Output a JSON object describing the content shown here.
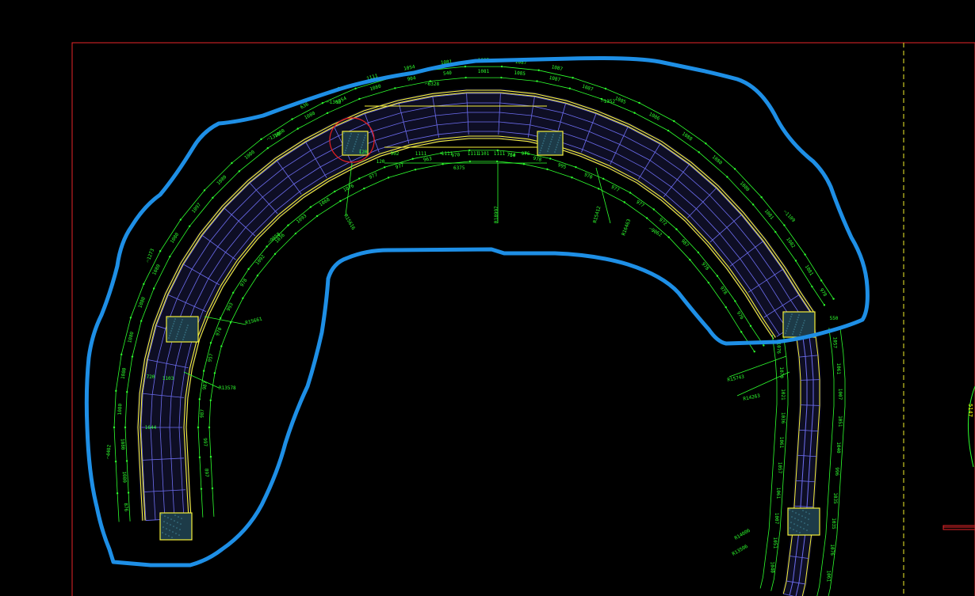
{
  "colors": {
    "background": "#000000",
    "frame": "#e8262a",
    "guide": "#f2ef2a",
    "outer_edge": "#f6f03a",
    "grid": "#6d6df0",
    "dimension": "#2eff2e",
    "highlight": "#1e8fe6",
    "marker": "#e81e1e",
    "column_fill": "#1d3b48"
  },
  "labels": {
    "top_arc": "⌒6328",
    "arc_1308": "⌒1308",
    "arc_1352": "⌒1352",
    "arc_1350": "⌒1350",
    "arc_1273": "⌒1273",
    "arc_1109": "⌒1109",
    "arc_4402": "⌒4402",
    "arc_9062": "⌒9062",
    "arc_9058": "⌒9058",
    "span_6375": "6375",
    "r_18997": "R18997",
    "r_15412": "R15412",
    "r_15616": "R15616",
    "r_15661": "R15661",
    "r_13578": "R13578",
    "r_14263": "R14263",
    "r_15743": "R15743",
    "r_14006": "R14006",
    "r_13506": "R13506",
    "r_16463": "R16463",
    "right_side": "5147"
  },
  "dimensions": {
    "top_row": [
      "636",
      "992",
      "1111",
      "1054",
      "1081",
      "1085",
      "1087",
      "1087"
    ],
    "left_outer": [
      "876",
      "1080",
      "1080",
      "1080",
      "1080",
      "1080",
      "1080",
      "1080",
      "1080",
      "1097",
      "1080",
      "1080",
      "1080",
      "1080",
      "1054",
      "1080",
      "904",
      "540"
    ],
    "left_inner": [
      "897",
      "997",
      "987",
      "987",
      "957",
      "970",
      "993",
      "978",
      "1092",
      "1036",
      "1093",
      "1068",
      "1076",
      "977",
      "977",
      "963",
      "970",
      "1101",
      "754"
    ],
    "inner_top": [
      "902",
      "1111",
      "1111",
      "1111",
      "1111",
      "976"
    ],
    "right_inner": [
      "760",
      "978",
      "995",
      "970",
      "977",
      "977",
      "972",
      "987",
      "978",
      "978",
      "976"
    ],
    "right_outer": [
      "1081",
      "1085",
      "1087",
      "1087",
      "1085",
      "1086",
      "1088",
      "1080",
      "1080",
      "1081",
      "1082",
      "1081",
      "978"
    ],
    "lower_right": [
      "1076",
      "1070",
      "1021",
      "1036",
      "1061",
      "1057",
      "1061",
      "1007",
      "1051",
      "1040",
      "996",
      "1035",
      "1035",
      "1076",
      "1061"
    ],
    "misc": [
      "120",
      "120",
      "550",
      "720",
      "1103",
      "1644",
      "1250",
      "1300",
      "1080",
      "1086"
    ]
  }
}
